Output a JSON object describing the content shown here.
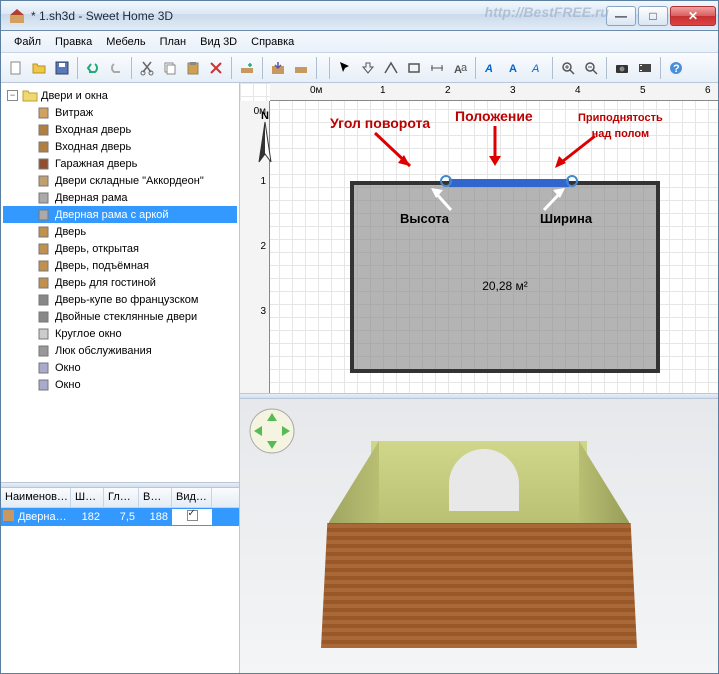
{
  "window": {
    "title": "* 1.sh3d - Sweet Home 3D",
    "watermark": "http://BestFREE.ru"
  },
  "menu": [
    "Файл",
    "Правка",
    "Мебель",
    "План",
    "Вид 3D",
    "Справка"
  ],
  "ruler_h": [
    "0м",
    "1",
    "2",
    "3",
    "4",
    "5",
    "6"
  ],
  "ruler_v": [
    "0м",
    "1",
    "2",
    "3"
  ],
  "tree": {
    "root": "Двери и окна",
    "items": [
      "Витраж",
      "Входная дверь",
      "Входная дверь",
      "Гаражная дверь",
      "Двери складные \"Аккордеон\"",
      "Дверная рама",
      "Дверная рама с аркой",
      "Дверь",
      "Дверь, открытая",
      "Дверь, подъёмная",
      "Дверь для гостиной",
      "Дверь-купе во французском",
      "Двойные стеклянные двери",
      "Круглое окно",
      "Люк обслуживания",
      "Окно",
      "Окно"
    ],
    "selected_index": 6
  },
  "furniture_table": {
    "headers": [
      "Наименов…",
      "Ш…",
      "Гл…",
      "В…",
      "Вид…"
    ],
    "row": {
      "name": "Дверна…",
      "w": "182",
      "d": "7,5",
      "h": "188"
    }
  },
  "plan": {
    "area": "20,28 м²",
    "annotations": {
      "angle": "Угол поворота",
      "position": "Положение",
      "elevation_l1": "Приподнятость",
      "elevation_l2": "над полом",
      "height": "Высота",
      "width": "Ширина"
    }
  }
}
